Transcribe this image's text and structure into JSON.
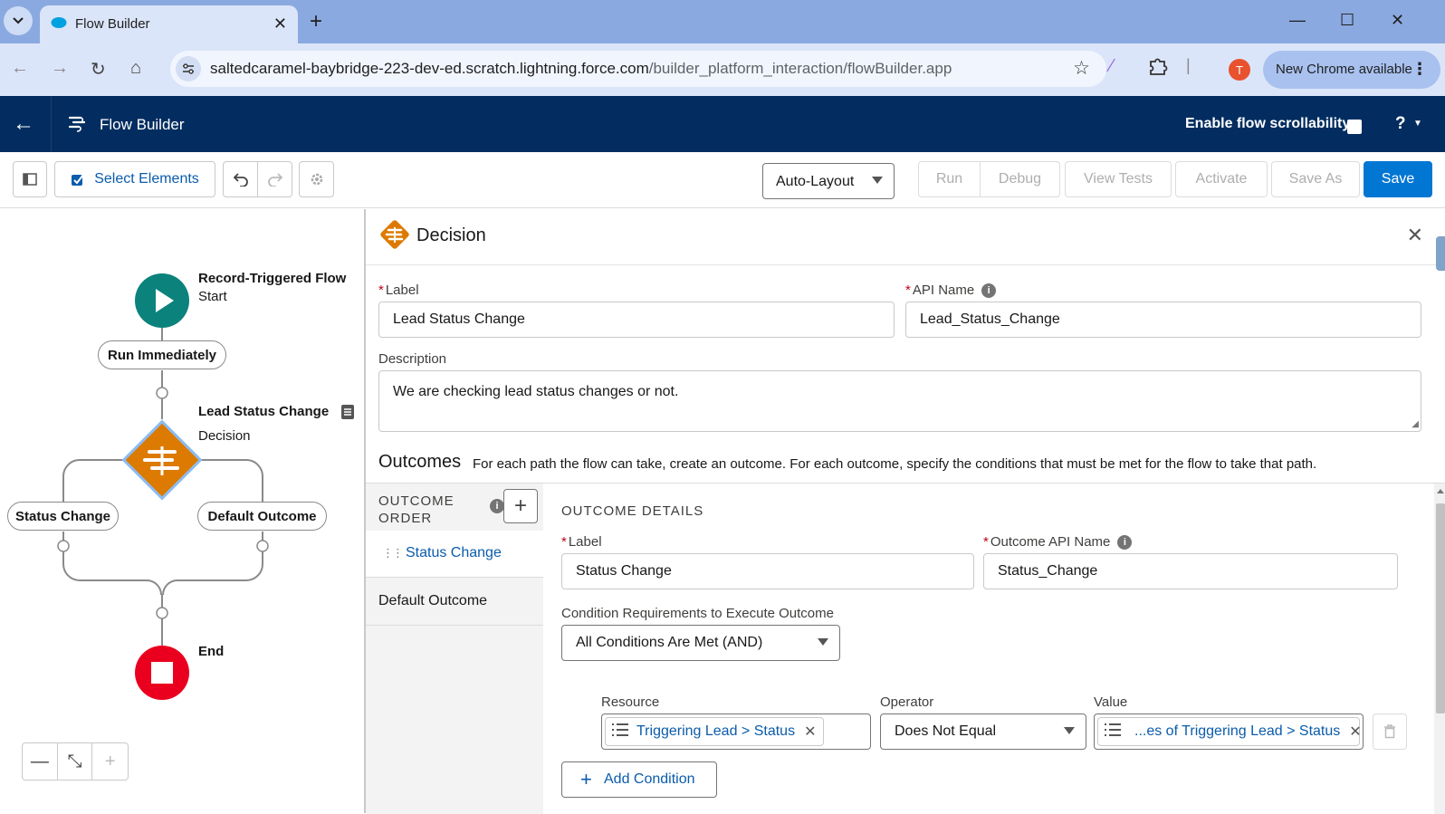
{
  "browser": {
    "tab_title": "Flow Builder",
    "url_host": "saltedcaramel-baybridge-223-dev-ed.scratch.lightning.force.com",
    "url_path": "/builder_platform_interaction/flowBuilder.app",
    "profile_initial": "T",
    "update_label": "New Chrome available"
  },
  "header": {
    "app_title": "Flow Builder",
    "scrollability_label": "Enable flow scrollability",
    "help_label": "?"
  },
  "toolbar": {
    "select_elements": "Select Elements",
    "layout_mode": "Auto-Layout",
    "run": "Run",
    "debug": "Debug",
    "view_tests": "View Tests",
    "activate": "Activate",
    "save_as": "Save As",
    "save": "Save"
  },
  "canvas": {
    "start_title": "Record-Triggered Flow",
    "start_sub": "Start",
    "run_immediately": "Run Immediately",
    "decision_title": "Lead Status Change",
    "decision_sub": "Decision",
    "branch_left": "Status Change",
    "branch_right": "Default Outcome",
    "end_title": "End",
    "zoom_out": "—",
    "fit": "⤡",
    "zoom_in": "+"
  },
  "panel": {
    "title": "Decision",
    "label_label": "Label",
    "label_value": "Lead Status Change",
    "api_label": "API Name",
    "api_value": "Lead_Status_Change",
    "description_label": "Description",
    "description_value": "We are checking lead status changes or not.",
    "outcomes_title": "Outcomes",
    "outcomes_help": "For each path the flow can take, create an outcome. For each outcome, specify the conditions that must be met for the flow to take that path.",
    "outcome_order_line1": "OUTCOME",
    "outcome_order_line2": "ORDER",
    "outcomes": [
      "Status Change",
      "Default Outcome"
    ],
    "details_head": "OUTCOME DETAILS",
    "outcome_label_label": "Label",
    "outcome_label_value": "Status Change",
    "outcome_api_label": "Outcome API Name",
    "outcome_api_value": "Status_Change",
    "condition_req_label": "Condition Requirements to Execute Outcome",
    "condition_req_value": "All Conditions Are Met (AND)",
    "resource_label": "Resource",
    "resource_value": "Triggering Lead > Status",
    "operator_label": "Operator",
    "operator_value": "Does Not Equal",
    "value_label": "Value",
    "value_value": "...es of Triggering Lead > Status",
    "add_condition": "Add Condition"
  },
  "colors": {
    "header_bg": "#032d60",
    "brand": "#0176d3",
    "decision": "#dd7a01",
    "start": "#0b827c",
    "end": "#ea001e"
  }
}
